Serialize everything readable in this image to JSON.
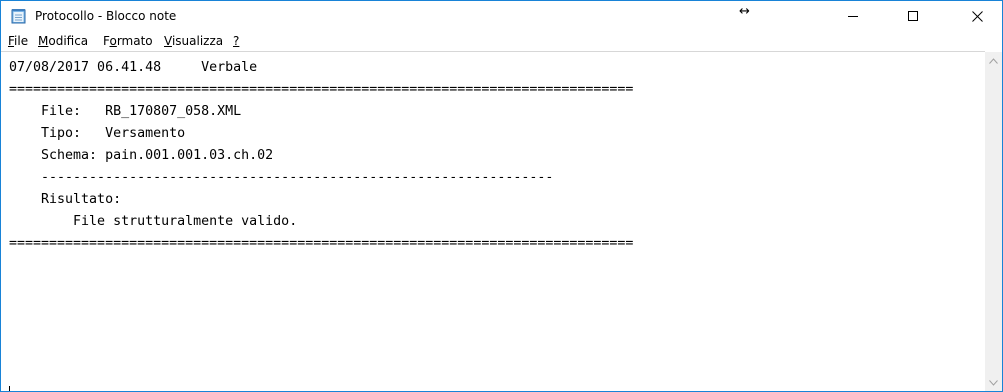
{
  "window": {
    "title": "Protocollo - Blocco note",
    "resize_glyph": "↔",
    "icons": {
      "app": "notepad-icon",
      "minimize": "minimize-icon",
      "maximize": "maximize-icon",
      "close": "close-icon"
    }
  },
  "menu": {
    "items": [
      {
        "label": "File",
        "mnemonic": "F",
        "rest": "ile"
      },
      {
        "label": "Modifica",
        "mnemonic": "M",
        "rest": "odifica"
      },
      {
        "label": "Formato",
        "pre": "F",
        "mnemonic": "o",
        "rest": "rmato"
      },
      {
        "label": "Visualizza",
        "mnemonic": "V",
        "rest": "isualizza"
      },
      {
        "label": "?",
        "mnemonic": "?",
        "rest": ""
      }
    ]
  },
  "document": {
    "lines": [
      "07/08/2017 06.41.48     Verbale",
      "==============================================================================",
      "    File:   RB_170807_058.XML",
      "    Tipo:   Versamento",
      "    Schema: pain.001.001.03.ch.02",
      "    ----------------------------------------------------------------",
      "    Risultato:",
      "        File strutturalmente valido.",
      "=============================================================================="
    ]
  },
  "colors": {
    "window_border": "#1883d7",
    "scrollbar_bg": "#f0f0f0",
    "text": "#000000"
  }
}
